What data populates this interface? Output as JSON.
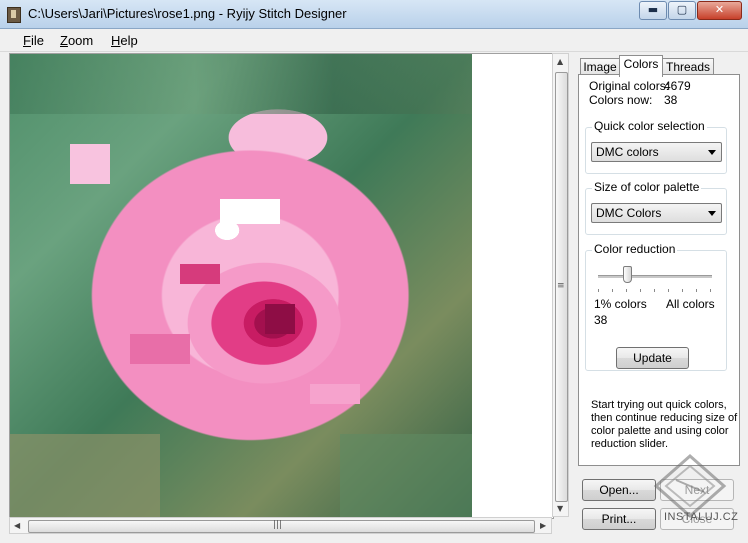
{
  "window": {
    "title": "C:\\Users\\Jari\\Pictures\\rose1.png - Ryijy Stitch Designer",
    "min_glyph": "▬",
    "max_glyph": "▢",
    "close_glyph": "✕"
  },
  "menu": {
    "items": [
      {
        "key": "F",
        "rest": "ile"
      },
      {
        "key": "Z",
        "rest": "oom"
      },
      {
        "key": "H",
        "rest": "elp"
      }
    ]
  },
  "tabs": [
    {
      "label": "Image",
      "active": false
    },
    {
      "label": "Colors",
      "active": true
    },
    {
      "label": "Threads",
      "active": false
    }
  ],
  "colors_tab": {
    "original_label": "Original colors:",
    "original_value": "4679",
    "now_label": "Colors now:",
    "now_value": "38",
    "quick": {
      "title": "Quick color selection",
      "selected": "DMC colors"
    },
    "palette": {
      "title": "Size of color palette",
      "selected": "DMC Colors"
    },
    "reduction": {
      "title": "Color reduction",
      "min_label": "1% colors",
      "max_label": "All colors",
      "current": "38",
      "level": 0.25,
      "update_label": "Update"
    },
    "help_text": "Start trying out quick colors, then continue reducing size of color palette and using color reduction slider."
  },
  "buttons": {
    "open": "Open...",
    "next": "Next",
    "print": "Print...",
    "close": "Close"
  },
  "scroll": {
    "grip": "≡",
    "hgrip": "|||",
    "up": "▲",
    "down": "▼",
    "left": "◀",
    "right": "▶"
  },
  "watermark": "INSTALUJ.CZ",
  "colors": {
    "accent_title": "#b9d1ea",
    "close_red": "#c7402a",
    "rose_pink": "#f38fc1",
    "rose_deep": "#c81c63",
    "leaf_green": "#4f8f6a"
  }
}
